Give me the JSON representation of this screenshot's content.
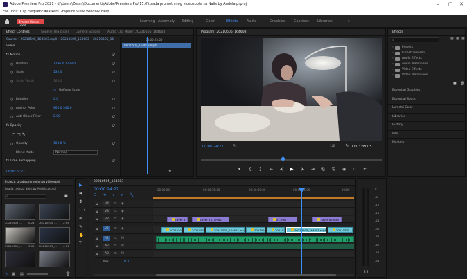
{
  "window": {
    "title": "Adobe Premiere Pro 2021 - d:\\Users\\Zoran\\Documenti\\Adobe\\Premiere Pro\\15.0\\izrada promotivnog videospota za Nails by Andela.prproj",
    "minimize": "–",
    "maximize": "▢",
    "close": "✕"
  },
  "menu": [
    "File",
    "Edit",
    "Clip",
    "Sequence",
    "Markers",
    "Graphics",
    "View",
    "Window",
    "Help"
  ],
  "header": {
    "home_icon": "home-icon",
    "system_status": "System Status Good",
    "workspaces": [
      "Learning",
      "Assembly",
      "Editing",
      "Color",
      "Effects",
      "Audio",
      "Graphics",
      "Captions",
      "Libraries"
    ],
    "active_workspace": "Effects",
    "more": "»"
  },
  "effect_controls": {
    "tabs": [
      "Effect Controls",
      "Source: (no clips)",
      "Lumetri Scopes",
      "Audio Clip Mixer: 20210505_164603"
    ],
    "source_line": "Source • 20210505_164603.mp4   •   20210505_164603 • 20210505_16",
    "clip_label": "20210505_164603.mp4",
    "time_marker": "00:00:23:00",
    "sections": [
      {
        "label": "Video",
        "kind": "header"
      },
      {
        "label": "fx  Motion",
        "kind": "effect"
      },
      {
        "label": "Position",
        "value": "1296.0    1728.0",
        "kind": "prop"
      },
      {
        "label": "Scale",
        "value": "132.0",
        "kind": "prop"
      },
      {
        "label": "Scale Width",
        "value": "100.0",
        "kind": "prop-dim"
      },
      {
        "label": "",
        "value": "Uniform Scale",
        "kind": "check"
      },
      {
        "label": "Rotation",
        "value": "0.0",
        "kind": "prop"
      },
      {
        "label": "Anchor Point",
        "value": "960.0    540.0",
        "kind": "prop"
      },
      {
        "label": "Anti-flicker Filter",
        "value": "0.00",
        "kind": "prop"
      },
      {
        "label": "fx  Opacity",
        "kind": "effect"
      },
      {
        "label": "",
        "value": "○ □ ✎",
        "kind": "masks"
      },
      {
        "label": "Opacity",
        "value": "100.0 %",
        "kind": "prop"
      },
      {
        "label": "Blend Mode",
        "value": "Normal",
        "kind": "select"
      },
      {
        "label": "fx  Time Remapping",
        "kind": "effect"
      }
    ],
    "bottom_time": "00:00:24:27"
  },
  "program": {
    "title": "Program: 20210505_164603",
    "menu_icon": "≡",
    "timecode": "00:00:24:27",
    "fit": "Fit",
    "quality": "1/2",
    "duration": "00:03:38:05",
    "controls": [
      "marker",
      "in",
      "out",
      "go-to-in",
      "step-back",
      "play",
      "step-forward",
      "go-to-out",
      "lift",
      "extract",
      "export-frame",
      "compare",
      "add"
    ]
  },
  "effects_panel": {
    "title": "Effects",
    "search_placeholder": "",
    "folders": [
      "Presets",
      "Lumetri Presets",
      "Audio Effects",
      "Audio Transitions",
      "Video Effects",
      "Video Transitions"
    ],
    "sections": [
      "Essential Graphics",
      "Essential Sound",
      "Lumetri Color",
      "Libraries",
      "History",
      "Info",
      "Markers"
    ]
  },
  "project": {
    "tab": "Project: izrada promotivnog videospot",
    "file": "izrada...ota za Nails by Andela.prproj",
    "items": [
      {
        "label": "20210505_...",
        "dur": "0:24"
      },
      {
        "label": "20210505_...",
        "dur": "2:09"
      },
      {
        "label": "20210505_...",
        "dur": "3:05"
      },
      {
        "label": "20210505_...",
        "dur": "4:11"
      },
      {
        "label": "",
        "dur": ""
      },
      {
        "label": "",
        "dur": ""
      }
    ]
  },
  "timeline": {
    "tab": "20210505_164603",
    "timecode": "00:00:24:27",
    "ruler": [
      "00:00:00",
      "00:00:15:00",
      "00:00:30:00",
      "00:00:45:00",
      "00:00"
    ],
    "tracks": [
      {
        "name": "V4"
      },
      {
        "name": "V3"
      },
      {
        "name": "V2"
      },
      {
        "name": "V1"
      },
      {
        "name": "A1"
      },
      {
        "name": "A2"
      },
      {
        "name": "A3"
      }
    ],
    "master_label": "Mix",
    "master_value": "0.0",
    "v2_clips": [
      {
        "label": "Layer B"
      },
      {
        "label": "Layer B (1).mov"
      },
      {
        "label": "01.mov"
      },
      {
        "label": "Layer B2.mov"
      }
    ],
    "v1_clips": [
      {
        "label": "20210505_1"
      },
      {
        "label": "20210505"
      },
      {
        "label": "20210505_164603.mp4 [V]"
      },
      {
        "label": "20210505"
      },
      {
        "label": "2021050"
      },
      {
        "label": "20210505_164603.mp4"
      },
      {
        "label": "20210505"
      }
    ]
  },
  "meter": {
    "labels": [
      "0",
      "-6",
      "-12",
      "-18",
      "-24",
      "-30",
      "-36",
      "-42",
      "-48",
      "-54"
    ],
    "solo": "S S"
  },
  "colors": {
    "accent": "#3e8ef7",
    "clip_purple": "#8c7bd3",
    "clip_cyan": "#6fc8d8",
    "audio_green": "#1fa06a",
    "status_red": "#e04848"
  }
}
